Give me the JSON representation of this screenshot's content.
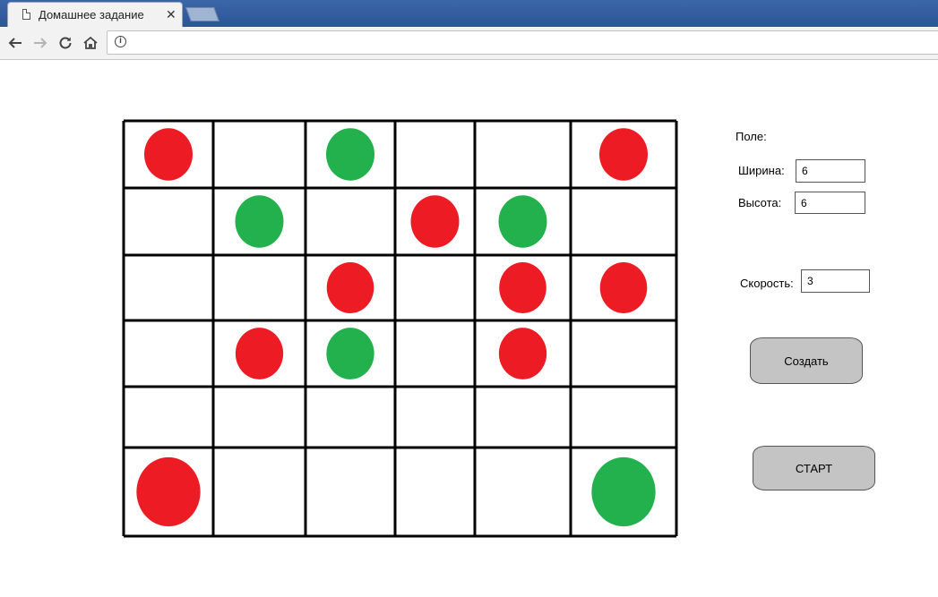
{
  "browser": {
    "tab_title": "Домашнее задание",
    "close_glyph": "✕",
    "info_glyph": "i"
  },
  "board": {
    "rows": 6,
    "cols": 6,
    "colors": {
      "red": "#ed1c24",
      "green": "#22b14c",
      "grid": "#000000"
    },
    "cells": [
      [
        "red",
        "",
        "green",
        "",
        "",
        "red"
      ],
      [
        "",
        "green",
        "",
        "red",
        "green",
        ""
      ],
      [
        "",
        "",
        "red",
        "",
        "red",
        "red"
      ],
      [
        "",
        "red",
        "green",
        "",
        "red",
        ""
      ],
      [
        "",
        "",
        "",
        "",
        "",
        ""
      ],
      [
        "red",
        "",
        "",
        "",
        "",
        "green"
      ]
    ]
  },
  "panel": {
    "field_label": "Поле:",
    "width_label": "Ширина:",
    "width_value": "6",
    "height_label": "Высота:",
    "height_value": "6",
    "speed_label": "Скорость:",
    "speed_value": "3",
    "create_button": "Создать",
    "start_button": "СТАРТ"
  }
}
